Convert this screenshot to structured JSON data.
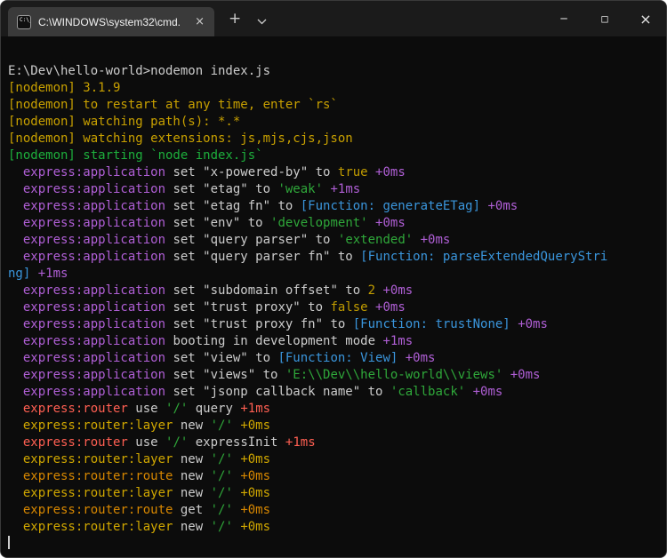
{
  "window": {
    "tab": {
      "icon_label": "C:\\_",
      "title": "C:\\WINDOWS\\system32\\cmd.",
      "close_label": "×"
    },
    "new_tab_label": "+",
    "controls": {
      "minimize": "─",
      "maximize": "□",
      "close": "×"
    }
  },
  "terminal": {
    "colors": {
      "background": "#0c0c0c",
      "fg": "#cccccc",
      "yellow": "#c8a000",
      "green": "#1daf3c",
      "purple": "#b05fd6",
      "value": "#c19c00",
      "string": "#2fa83a",
      "blue": "#3a96dd",
      "red": "#ff5f52",
      "gold": "#d0a700",
      "orange": "#d78700"
    },
    "lines": [
      [
        {
          "t": "E:\\Dev\\hello-world>nodemon index.js",
          "c": "fg"
        }
      ],
      [
        {
          "t": "[nodemon] 3.1.9",
          "c": "yellow"
        }
      ],
      [
        {
          "t": "[nodemon] to restart at any time, enter `rs`",
          "c": "yellow"
        }
      ],
      [
        {
          "t": "[nodemon] watching path(s): *.*",
          "c": "yellow"
        }
      ],
      [
        {
          "t": "[nodemon] watching extensions: js,mjs,cjs,json",
          "c": "yellow"
        }
      ],
      [
        {
          "t": "[nodemon] starting `node index.js`",
          "c": "green"
        }
      ],
      [
        {
          "t": "  ",
          "c": "fg"
        },
        {
          "t": "express:application",
          "c": "purple"
        },
        {
          "t": " set \"x-powered-by\" to ",
          "c": "fg"
        },
        {
          "t": "true",
          "c": "value"
        },
        {
          "t": " ",
          "c": "fg"
        },
        {
          "t": "+0ms",
          "c": "purple"
        }
      ],
      [
        {
          "t": "  ",
          "c": "fg"
        },
        {
          "t": "express:application",
          "c": "purple"
        },
        {
          "t": " set \"etag\" to ",
          "c": "fg"
        },
        {
          "t": "'weak'",
          "c": "string"
        },
        {
          "t": " ",
          "c": "fg"
        },
        {
          "t": "+1ms",
          "c": "purple"
        }
      ],
      [
        {
          "t": "  ",
          "c": "fg"
        },
        {
          "t": "express:application",
          "c": "purple"
        },
        {
          "t": " set \"etag fn\" to ",
          "c": "fg"
        },
        {
          "t": "[Function: generateETag]",
          "c": "blue"
        },
        {
          "t": " ",
          "c": "fg"
        },
        {
          "t": "+0ms",
          "c": "purple"
        }
      ],
      [
        {
          "t": "  ",
          "c": "fg"
        },
        {
          "t": "express:application",
          "c": "purple"
        },
        {
          "t": " set \"env\" to ",
          "c": "fg"
        },
        {
          "t": "'development'",
          "c": "string"
        },
        {
          "t": " ",
          "c": "fg"
        },
        {
          "t": "+0ms",
          "c": "purple"
        }
      ],
      [
        {
          "t": "  ",
          "c": "fg"
        },
        {
          "t": "express:application",
          "c": "purple"
        },
        {
          "t": " set \"query parser\" to ",
          "c": "fg"
        },
        {
          "t": "'extended'",
          "c": "string"
        },
        {
          "t": " ",
          "c": "fg"
        },
        {
          "t": "+0ms",
          "c": "purple"
        }
      ],
      [
        {
          "t": "  ",
          "c": "fg"
        },
        {
          "t": "express:application",
          "c": "purple"
        },
        {
          "t": " set \"query parser fn\" to ",
          "c": "fg"
        },
        {
          "t": "[Function: parseExtendedQueryStri",
          "c": "blue"
        }
      ],
      [
        {
          "t": "ng]",
          "c": "blue"
        },
        {
          "t": " ",
          "c": "fg"
        },
        {
          "t": "+1ms",
          "c": "purple"
        }
      ],
      [
        {
          "t": "  ",
          "c": "fg"
        },
        {
          "t": "express:application",
          "c": "purple"
        },
        {
          "t": " set \"subdomain offset\" to ",
          "c": "fg"
        },
        {
          "t": "2",
          "c": "value"
        },
        {
          "t": " ",
          "c": "fg"
        },
        {
          "t": "+0ms",
          "c": "purple"
        }
      ],
      [
        {
          "t": "  ",
          "c": "fg"
        },
        {
          "t": "express:application",
          "c": "purple"
        },
        {
          "t": " set \"trust proxy\" to ",
          "c": "fg"
        },
        {
          "t": "false",
          "c": "value"
        },
        {
          "t": " ",
          "c": "fg"
        },
        {
          "t": "+0ms",
          "c": "purple"
        }
      ],
      [
        {
          "t": "  ",
          "c": "fg"
        },
        {
          "t": "express:application",
          "c": "purple"
        },
        {
          "t": " set \"trust proxy fn\" to ",
          "c": "fg"
        },
        {
          "t": "[Function: trustNone]",
          "c": "blue"
        },
        {
          "t": " ",
          "c": "fg"
        },
        {
          "t": "+0ms",
          "c": "purple"
        }
      ],
      [
        {
          "t": "  ",
          "c": "fg"
        },
        {
          "t": "express:application",
          "c": "purple"
        },
        {
          "t": " booting in development mode ",
          "c": "fg"
        },
        {
          "t": "+1ms",
          "c": "purple"
        }
      ],
      [
        {
          "t": "  ",
          "c": "fg"
        },
        {
          "t": "express:application",
          "c": "purple"
        },
        {
          "t": " set \"view\" to ",
          "c": "fg"
        },
        {
          "t": "[Function: View]",
          "c": "blue"
        },
        {
          "t": " ",
          "c": "fg"
        },
        {
          "t": "+0ms",
          "c": "purple"
        }
      ],
      [
        {
          "t": "  ",
          "c": "fg"
        },
        {
          "t": "express:application",
          "c": "purple"
        },
        {
          "t": " set \"views\" to ",
          "c": "fg"
        },
        {
          "t": "'E:\\\\Dev\\\\hello-world\\\\views'",
          "c": "string"
        },
        {
          "t": " ",
          "c": "fg"
        },
        {
          "t": "+0ms",
          "c": "purple"
        }
      ],
      [
        {
          "t": "  ",
          "c": "fg"
        },
        {
          "t": "express:application",
          "c": "purple"
        },
        {
          "t": " set \"jsonp callback name\" to ",
          "c": "fg"
        },
        {
          "t": "'callback'",
          "c": "string"
        },
        {
          "t": " ",
          "c": "fg"
        },
        {
          "t": "+0ms",
          "c": "purple"
        }
      ],
      [
        {
          "t": "  ",
          "c": "fg"
        },
        {
          "t": "express:router",
          "c": "red"
        },
        {
          "t": " use ",
          "c": "fg"
        },
        {
          "t": "'/'",
          "c": "string"
        },
        {
          "t": " query ",
          "c": "fg"
        },
        {
          "t": "+1ms",
          "c": "red"
        }
      ],
      [
        {
          "t": "  ",
          "c": "fg"
        },
        {
          "t": "express:router:layer",
          "c": "gold"
        },
        {
          "t": " new ",
          "c": "fg"
        },
        {
          "t": "'/'",
          "c": "string"
        },
        {
          "t": " ",
          "c": "fg"
        },
        {
          "t": "+0ms",
          "c": "gold"
        }
      ],
      [
        {
          "t": "  ",
          "c": "fg"
        },
        {
          "t": "express:router",
          "c": "red"
        },
        {
          "t": " use ",
          "c": "fg"
        },
        {
          "t": "'/'",
          "c": "string"
        },
        {
          "t": " expressInit ",
          "c": "fg"
        },
        {
          "t": "+1ms",
          "c": "red"
        }
      ],
      [
        {
          "t": "  ",
          "c": "fg"
        },
        {
          "t": "express:router:layer",
          "c": "gold"
        },
        {
          "t": " new ",
          "c": "fg"
        },
        {
          "t": "'/'",
          "c": "string"
        },
        {
          "t": " ",
          "c": "fg"
        },
        {
          "t": "+0ms",
          "c": "gold"
        }
      ],
      [
        {
          "t": "  ",
          "c": "fg"
        },
        {
          "t": "express:router:route",
          "c": "orange"
        },
        {
          "t": " new ",
          "c": "fg"
        },
        {
          "t": "'/'",
          "c": "string"
        },
        {
          "t": " ",
          "c": "fg"
        },
        {
          "t": "+0ms",
          "c": "orange"
        }
      ],
      [
        {
          "t": "  ",
          "c": "fg"
        },
        {
          "t": "express:router:layer",
          "c": "gold"
        },
        {
          "t": " new ",
          "c": "fg"
        },
        {
          "t": "'/'",
          "c": "string"
        },
        {
          "t": " ",
          "c": "fg"
        },
        {
          "t": "+0ms",
          "c": "gold"
        }
      ],
      [
        {
          "t": "  ",
          "c": "fg"
        },
        {
          "t": "express:router:route",
          "c": "orange"
        },
        {
          "t": " get ",
          "c": "fg"
        },
        {
          "t": "'/'",
          "c": "string"
        },
        {
          "t": " ",
          "c": "fg"
        },
        {
          "t": "+0ms",
          "c": "orange"
        }
      ],
      [
        {
          "t": "  ",
          "c": "fg"
        },
        {
          "t": "express:router:layer",
          "c": "gold"
        },
        {
          "t": " new ",
          "c": "fg"
        },
        {
          "t": "'/'",
          "c": "string"
        },
        {
          "t": " ",
          "c": "fg"
        },
        {
          "t": "+0ms",
          "c": "gold"
        }
      ]
    ],
    "cursor_visible": true
  }
}
